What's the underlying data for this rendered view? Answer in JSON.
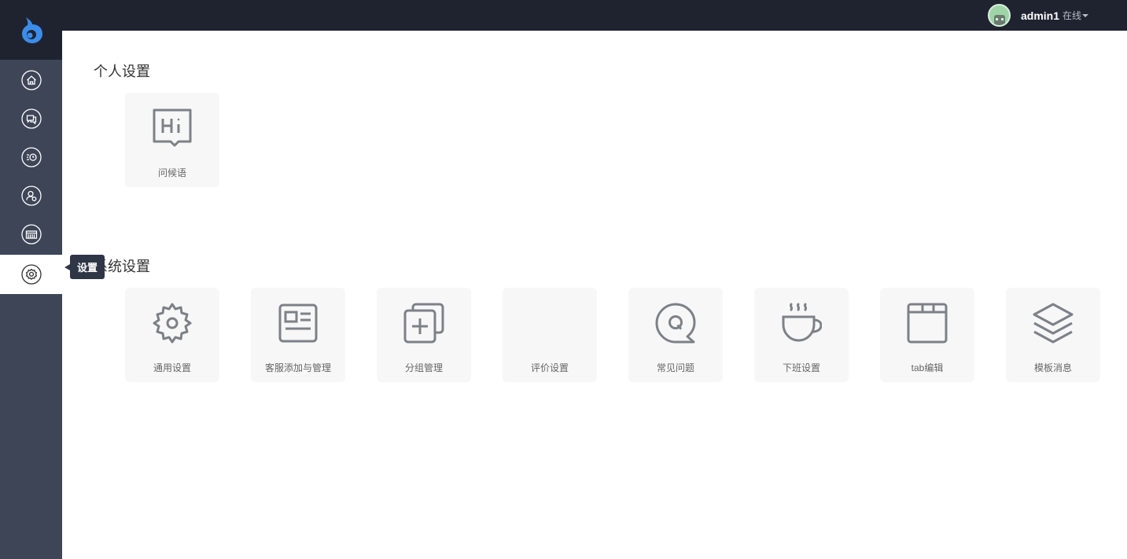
{
  "header": {
    "logo_icon": "logo-icon",
    "user": {
      "name": "admin1",
      "status": "在线",
      "avatar_icon": "avatar-icon"
    }
  },
  "sidebar": {
    "items": [
      {
        "icon": "home-icon"
      },
      {
        "icon": "chat-icon"
      },
      {
        "icon": "history-icon"
      },
      {
        "icon": "user-icon"
      },
      {
        "icon": "keyboard-icon"
      },
      {
        "icon": "gear-icon",
        "active": true
      }
    ],
    "tooltip": "设置"
  },
  "sections": [
    {
      "title": "个人设置",
      "cards": [
        {
          "label": "问候语",
          "icon": "hi-bubble-icon"
        }
      ]
    },
    {
      "title": "系统设置",
      "cards": [
        {
          "label": "通用设置",
          "icon": "gear-icon"
        },
        {
          "label": "客服添加与管理",
          "icon": "id-card-icon"
        },
        {
          "label": "分组管理",
          "icon": "add-group-icon"
        },
        {
          "label": "评价设置",
          "icon": ""
        },
        {
          "label": "常见问题",
          "icon": "faq-bubble-icon"
        },
        {
          "label": "下班设置",
          "icon": "coffee-cup-icon"
        },
        {
          "label": "tab编辑",
          "icon": "folder-tab-icon"
        },
        {
          "label": "模板消息",
          "icon": "layers-icon"
        }
      ]
    }
  ],
  "colors": {
    "topbar": "#1f2330",
    "sidebar": "#3d4557",
    "card_bg": "#f7f7f7",
    "icon_stroke": "#7d8187",
    "logo": "#3c8dea"
  }
}
